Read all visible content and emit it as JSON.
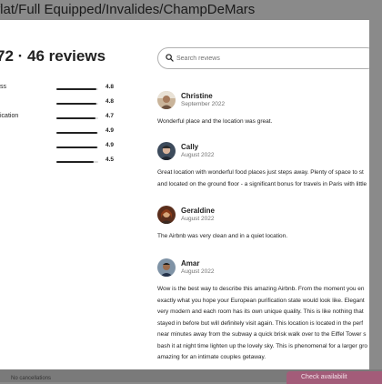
{
  "listing": {
    "title": "flat/Full Equipped/Invalides/ChampDeMars"
  },
  "reviews_header": {
    "heading": "72 · 46 reviews"
  },
  "categories": [
    {
      "label": "ss",
      "score": "4.8",
      "fraction": 0.96
    },
    {
      "label": "",
      "score": "4.8",
      "fraction": 0.96
    },
    {
      "label": "ication",
      "score": "4.7",
      "fraction": 0.94
    },
    {
      "label": "",
      "score": "4.9",
      "fraction": 0.98
    },
    {
      "label": "",
      "score": "4.9",
      "fraction": 0.98
    },
    {
      "label": "",
      "score": "4.5",
      "fraction": 0.9
    }
  ],
  "search": {
    "placeholder": "Search reviews"
  },
  "reviews": [
    {
      "name": "Christine",
      "date": "September 2022",
      "lines": [
        "Wonderful place and the location was great."
      ]
    },
    {
      "name": "Cally",
      "date": "August 2022",
      "lines": [
        "Great location with wonderful food places just steps away. Plenty of space to st",
        "and located on the ground floor - a significant bonus for travels in Paris with little"
      ]
    },
    {
      "name": "Geraldine",
      "date": "August 2022",
      "lines": [
        "The Airbnb was very clean and in a quiet location."
      ]
    },
    {
      "name": "Amar",
      "date": "August 2022",
      "lines": [
        "Wow is the best way to describe this amazing Airbnb. From the moment you en",
        "exactly what you hope your European purification state would look like. Elegant",
        "very modern and each room has its own unique quality. This is like nothing that",
        "stayed in before but will definitely visit again. This location is located in the perf",
        "near minutes away from the subway a quick brisk walk over to the Eiffel Tower s",
        "bash it at night time lighten up the lovely sky. This is phenomenal for a larger gro",
        "amazing for an intimate couples getaway."
      ]
    }
  ],
  "footer": {
    "text": "No cancellations",
    "checkout_label": "Check availabilit"
  },
  "colors": {
    "accent": "#a35c79",
    "text": "#222222",
    "muted": "#717171"
  }
}
